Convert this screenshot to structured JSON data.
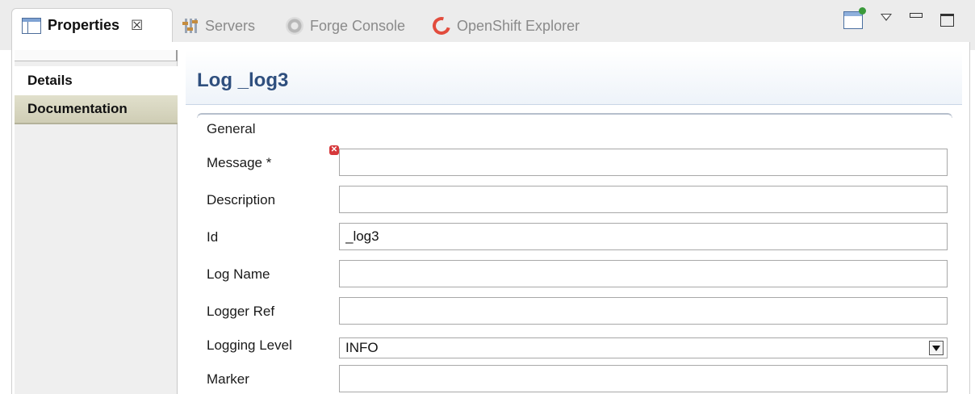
{
  "tabs": [
    {
      "label": "Properties",
      "icon": "properties-icon",
      "active": true
    },
    {
      "label": "Servers",
      "icon": "servers-icon"
    },
    {
      "label": "Forge Console",
      "icon": "forge-console-icon"
    },
    {
      "label": "OpenShift Explorer",
      "icon": "openshift-icon"
    }
  ],
  "tab_close_glyph": "☒",
  "sidebar": {
    "items": [
      {
        "label": "Details",
        "selected": true
      },
      {
        "label": "Documentation",
        "selected": false
      }
    ]
  },
  "main": {
    "title": "Log _log3",
    "section": "General",
    "fields": {
      "message": {
        "label": "Message *",
        "value": ""
      },
      "description": {
        "label": "Description",
        "value": ""
      },
      "id": {
        "label": "Id",
        "value": "_log3"
      },
      "log_name": {
        "label": "Log Name",
        "value": ""
      },
      "logger_ref": {
        "label": "Logger Ref",
        "value": ""
      },
      "logging_level": {
        "label": "Logging Level",
        "value": "INFO"
      },
      "marker": {
        "label": "Marker",
        "value": ""
      }
    }
  },
  "colors": {
    "title": "#2f4f7e",
    "error": "#d6383b",
    "doc_tab": "#d8d6c0"
  }
}
